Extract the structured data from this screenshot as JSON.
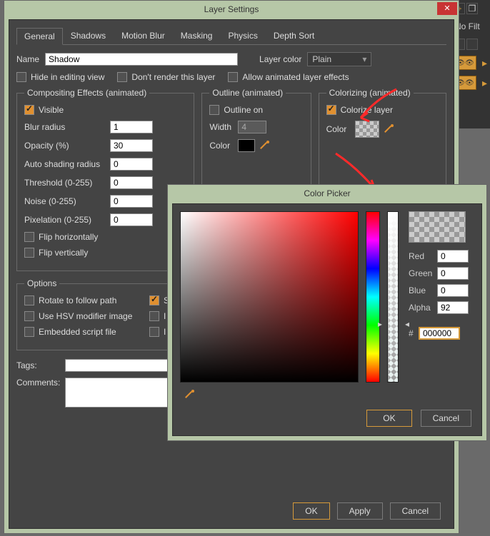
{
  "layerSettings": {
    "title": "Layer Settings",
    "tabs": [
      "General",
      "Shadows",
      "Motion Blur",
      "Masking",
      "Physics",
      "Depth Sort"
    ],
    "nameLabel": "Name",
    "nameValue": "Shadow",
    "layerColorLabel": "Layer color",
    "layerColorValue": "Plain",
    "hideInEditing": "Hide in editing view",
    "dontRender": "Don't render this layer",
    "allowAnimated": "Allow animated layer effects",
    "compositing": {
      "legend": "Compositing Effects (animated)",
      "visible": "Visible",
      "blurRadius": "Blur radius",
      "blurRadiusVal": "1",
      "opacity": "Opacity (%)",
      "opacityVal": "30",
      "autoShading": "Auto shading radius",
      "autoShadingVal": "0",
      "threshold": "Threshold (0-255)",
      "thresholdVal": "0",
      "noise": "Noise (0-255)",
      "noiseVal": "0",
      "pixelation": "Pixelation (0-255)",
      "pixelationVal": "0",
      "flipH": "Flip horizontally",
      "flipV": "Flip vertically"
    },
    "outline": {
      "legend": "Outline (animated)",
      "outlineOn": "Outline on",
      "width": "Width",
      "widthVal": "4",
      "color": "Color"
    },
    "colorizing": {
      "legend": "Colorizing (animated)",
      "colorizeLayer": "Colorize layer",
      "color": "Color"
    },
    "options": {
      "legend": "Options",
      "rotate": "Rotate to follow path",
      "sCheck": "S",
      "hsv": "Use HSV modifier image",
      "iLabel": "I",
      "embedded": "Embedded script file"
    },
    "tagsLabel": "Tags:",
    "commentsLabel": "Comments:",
    "ok": "OK",
    "apply": "Apply",
    "cancel": "Cancel"
  },
  "colorPicker": {
    "title": "Color Picker",
    "redLabel": "Red",
    "redVal": "0",
    "greenLabel": "Green",
    "greenVal": "0",
    "blueLabel": "Blue",
    "blueVal": "0",
    "alphaLabel": "Alpha",
    "alphaVal": "92",
    "hexLabel": "#",
    "hexVal": "000000",
    "ok": "OK",
    "cancel": "Cancel"
  },
  "dock": {
    "noFilter": "No Filt"
  }
}
